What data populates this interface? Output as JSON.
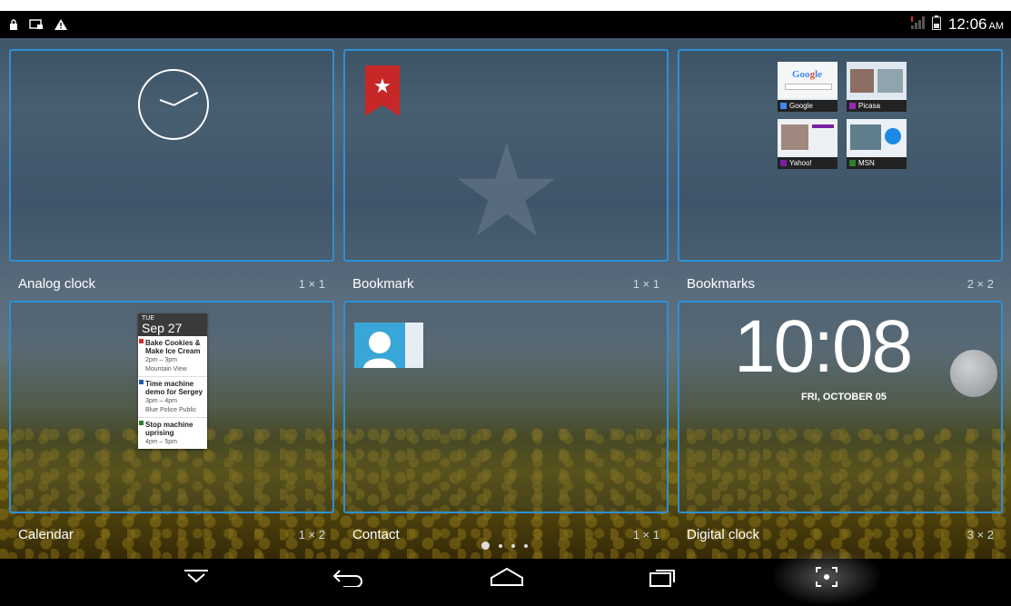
{
  "status_bar": {
    "time": "12:06",
    "ampm": "AM",
    "icons_left": [
      "lock-icon",
      "screenshot-icon",
      "warning-icon"
    ],
    "icons_right": [
      "signal-icon",
      "battery-icon"
    ]
  },
  "widgets": [
    {
      "name": "Analog clock",
      "size": "1 × 1"
    },
    {
      "name": "Bookmark",
      "size": "1 × 1"
    },
    {
      "name": "Bookmarks",
      "size": "2 × 2"
    },
    {
      "name": "Calendar",
      "size": "1 × 2"
    },
    {
      "name": "Contact",
      "size": "1 × 1"
    },
    {
      "name": "Digital clock",
      "size": "3 × 2"
    }
  ],
  "bookmark_thumbs": [
    {
      "label": "Google",
      "color": "#4285f4"
    },
    {
      "label": "Picasa",
      "color": "#9c27b0"
    },
    {
      "label": "Yahoo!",
      "color": "#7b1fa2"
    },
    {
      "label": "MSN",
      "color": "#2e7d32"
    }
  ],
  "calendar_preview": {
    "day_of_week": "TUE",
    "date": "Sep 27",
    "events": [
      {
        "title": "Bake Cookies & Make Ice Cream",
        "time": "2pm – 3pm",
        "location": "Mountain View",
        "color": "#d32f2f"
      },
      {
        "title": "Time machine demo for Sergey",
        "time": "3pm – 4pm",
        "location": "Blue Police Public",
        "color": "#1e5aa8"
      },
      {
        "title": "Stop machine uprising",
        "time": "4pm – 5pm",
        "location": "",
        "color": "#2e7d32"
      }
    ]
  },
  "digital_clock_preview": {
    "time": "10:08",
    "date": "FRI, OCTOBER 05"
  },
  "page_indicator": {
    "current": 1,
    "total": 4
  },
  "nav_bar": [
    "hide-keyboard-icon",
    "back-icon",
    "home-icon",
    "recent-apps-icon",
    "screenshot-capture-icon"
  ],
  "colors": {
    "accent": "#2e8fd6",
    "statusbar": "#000000"
  }
}
